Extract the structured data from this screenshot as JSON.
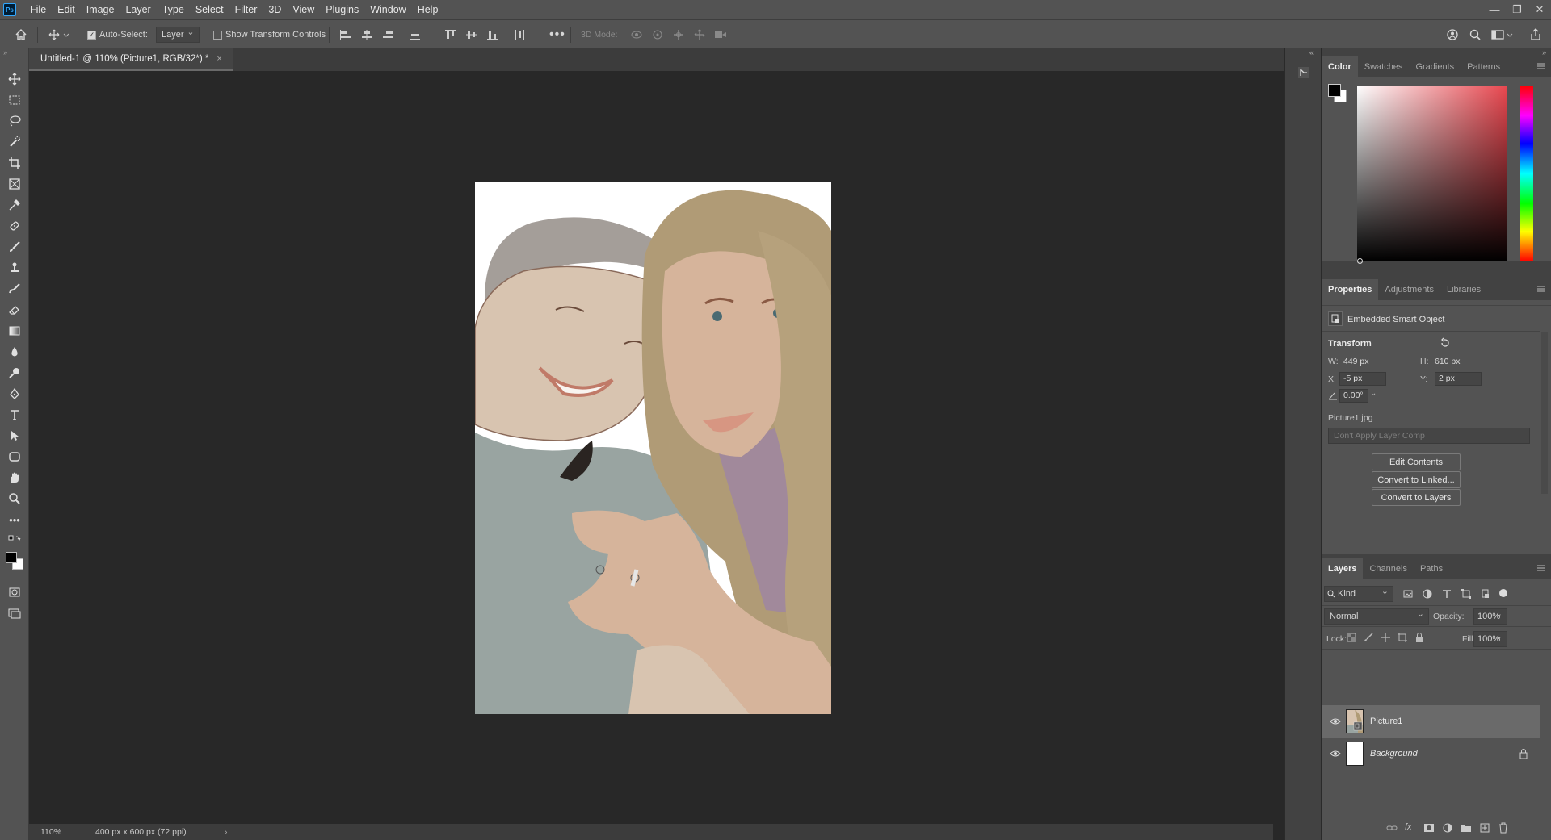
{
  "menubar": {
    "logo": "Ps",
    "items": [
      "File",
      "Edit",
      "Image",
      "Layer",
      "Type",
      "Select",
      "Filter",
      "3D",
      "View",
      "Plugins",
      "Window",
      "Help"
    ]
  },
  "options": {
    "auto_select_label": "Auto-Select:",
    "auto_select_checked": true,
    "auto_select_value": "Layer",
    "show_transform_label": "Show Transform Controls",
    "show_transform_checked": false,
    "mode_3d_label": "3D Mode:"
  },
  "document": {
    "tab_title": "Untitled-1 @ 110% (Picture1, RGB/32*) *",
    "close_glyph": "×"
  },
  "status": {
    "zoom": "110%",
    "doc_info": "400 px x 600 px (72 ppi)",
    "arrow": "›"
  },
  "color_panel": {
    "tabs": [
      "Color",
      "Swatches",
      "Gradients",
      "Patterns"
    ],
    "foreground": "#000000",
    "background": "#ffffff",
    "hue_base": "#e8474f"
  },
  "properties_panel": {
    "tabs": [
      "Properties",
      "Adjustments",
      "Libraries"
    ],
    "object_type": "Embedded Smart Object",
    "section_title": "Transform",
    "w_label": "W:",
    "w_value": "449 px",
    "h_label": "H:",
    "h_value": "610 px",
    "x_label": "X:",
    "x_value": "-5 px",
    "y_label": "Y:",
    "y_value": "2 px",
    "angle_value": "0.00°",
    "source_file": "Picture1.jpg",
    "layer_comp_placeholder": "Don't Apply Layer Comp",
    "buttons": [
      "Edit Contents",
      "Convert to Linked...",
      "Convert to Layers"
    ]
  },
  "layers_panel": {
    "tabs": [
      "Layers",
      "Channels",
      "Paths"
    ],
    "filter_label": "Kind",
    "blend_mode": "Normal",
    "opacity_label": "Opacity:",
    "opacity_value": "100%",
    "lock_label": "Lock:",
    "fill_label": "Fill:",
    "fill_value": "100%",
    "layers": [
      {
        "name": "Picture1",
        "visible": true,
        "selected": true
      },
      {
        "name": "Background",
        "visible": true,
        "locked": true
      }
    ]
  },
  "icons": {
    "tools": [
      "move-icon",
      "marquee-icon",
      "lasso-icon",
      "quick-select-icon",
      "crop-icon",
      "frame-icon",
      "eyedropper-icon",
      "healing-brush-icon",
      "brush-icon",
      "stamp-icon",
      "history-brush-icon",
      "eraser-icon",
      "gradient-icon",
      "blur-icon",
      "dodge-icon",
      "pen-icon",
      "type-icon",
      "path-select-icon",
      "shape-icon",
      "hand-icon",
      "zoom-icon",
      "more-tools-icon"
    ]
  }
}
